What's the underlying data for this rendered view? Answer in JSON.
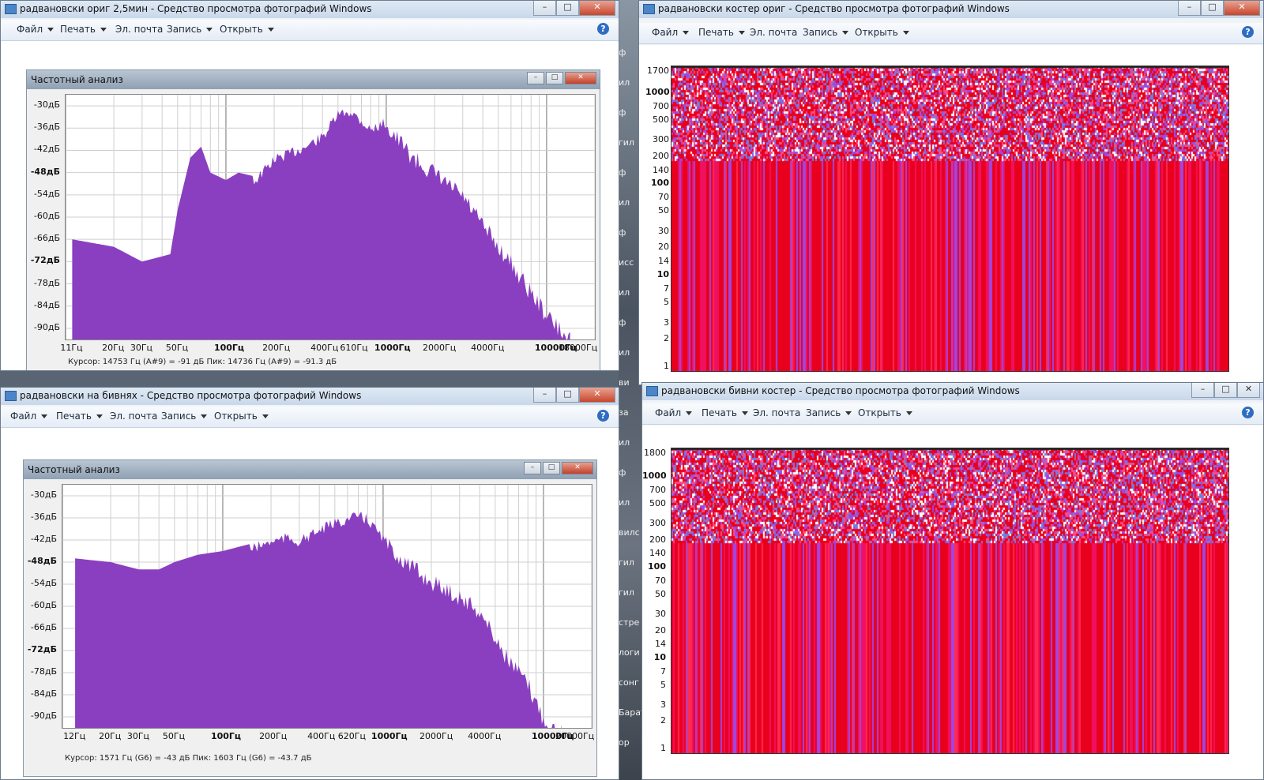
{
  "menu": {
    "file": "Файл",
    "print": "Печать",
    "email": "Эл. почта",
    "burn": "Запись",
    "open": "Открыть"
  },
  "desktop_labels": [
    "ф",
    "ил",
    "ф",
    "гил",
    "ф",
    "ил",
    "ф",
    "исс",
    "ил",
    "ф",
    "ил",
    "ви",
    "за",
    "ил",
    "ф",
    "ил",
    "вилс",
    "гил",
    "гил",
    "стре",
    "логи",
    "сонг",
    "Барат",
    "ор"
  ],
  "windows": [
    {
      "id": "w1",
      "title": "радвановски ориг 2,5мин - Средство просмотра фотографий Windows",
      "panel_title": "Частотный анализ",
      "y_ticks": [
        "-30дБ",
        "-36дБ",
        "-42дБ",
        "-48дБ",
        "-54дБ",
        "-60дБ",
        "-66дБ",
        "-72дБ",
        "-78дБ",
        "-84дБ",
        "-90дБ"
      ],
      "x_ticks": [
        "11Гц",
        "20Гц",
        "30Гц",
        "50Гц",
        "100Гц",
        "200Гц",
        "400Гц",
        "610Гц",
        "1000Гц",
        "2000Гц",
        "4000Гц",
        "10000Гц",
        "18000Гц"
      ],
      "status": "Курсор: 14753 Гц (A#9) = -91 дБ     Пик: 14736 Гц (A#9) = -91.3 дБ"
    },
    {
      "id": "w2",
      "title": "радвановски на бивнях - Средство просмотра фотографий Windows",
      "panel_title": "Частотный анализ",
      "y_ticks": [
        "-30дБ",
        "-36дБ",
        "-42дБ",
        "-48дБ",
        "-54дБ",
        "-60дБ",
        "-66дБ",
        "-72дБ",
        "-78дБ",
        "-84дБ",
        "-90дБ"
      ],
      "x_ticks": [
        "12Гц",
        "20Гц",
        "30Гц",
        "50Гц",
        "100Гц",
        "200Гц",
        "400Гц",
        "620Гц",
        "1000Гц",
        "2000Гц",
        "4000Гц",
        "10000Гц",
        "20000Гц"
      ],
      "status": "Курсор: 1571 Гц (G6) = -43 дБ     Пик: 1603 Гц (G6) = -43.7 дБ"
    },
    {
      "id": "w3",
      "title": "радвановски костер ориг - Средство просмотра фотографий Windows",
      "y_ticks": [
        "1700",
        "1000",
        "700",
        "500",
        "300",
        "200",
        "140",
        "100",
        "70",
        "50",
        "30",
        "20",
        "14",
        "10",
        "7",
        "5",
        "3",
        "2",
        "1"
      ]
    },
    {
      "id": "w4",
      "title": "радвановски бивни костер - Средство просмотра фотографий Windows",
      "y_ticks": [
        "1800",
        "1000",
        "700",
        "500",
        "300",
        "200",
        "140",
        "100",
        "70",
        "50",
        "30",
        "20",
        "14",
        "10",
        "7",
        "5",
        "3",
        "2",
        "1"
      ]
    }
  ],
  "colors": {
    "spectrum": "#8a3fc0",
    "spec_red": "#e8001c",
    "spec_purple": "#a046e0",
    "spec_blue": "#6f7fe0",
    "spec_white": "#ffffff"
  },
  "chart_data": [
    {
      "type": "area",
      "title": "Частотный анализ",
      "x_scale": "log",
      "ylim": [
        -93,
        -27
      ],
      "x": [
        11,
        20,
        30,
        45,
        50,
        60,
        70,
        80,
        100,
        120,
        150,
        200,
        300,
        400,
        500,
        600,
        800,
        1000,
        1500,
        2000,
        3000,
        4000,
        6000,
        8000,
        10000,
        12000,
        14000
      ],
      "y": [
        -66,
        -68,
        -72,
        -70,
        -58,
        -44,
        -41,
        -48,
        -50,
        -48,
        -49,
        -43,
        -40,
        -37,
        -31,
        -30,
        -35,
        -33,
        -42,
        -46,
        -52,
        -60,
        -70,
        -78,
        -84,
        -88,
        -91
      ]
    },
    {
      "type": "area",
      "title": "Частотный анализ",
      "x_scale": "log",
      "ylim": [
        -93,
        -27
      ],
      "x": [
        12,
        20,
        30,
        40,
        50,
        70,
        100,
        150,
        200,
        250,
        300,
        400,
        500,
        600,
        700,
        800,
        1000,
        1500,
        2000,
        3000,
        4000,
        6000,
        8000,
        10000,
        13000
      ],
      "y": [
        -47,
        -48,
        -50,
        -50,
        -48,
        -46,
        -45,
        -43,
        -41,
        -40,
        -41,
        -38,
        -36,
        -35,
        -34,
        -35,
        -40,
        -47,
        -51,
        -55,
        -59,
        -72,
        -79,
        -88,
        -92
      ]
    }
  ]
}
